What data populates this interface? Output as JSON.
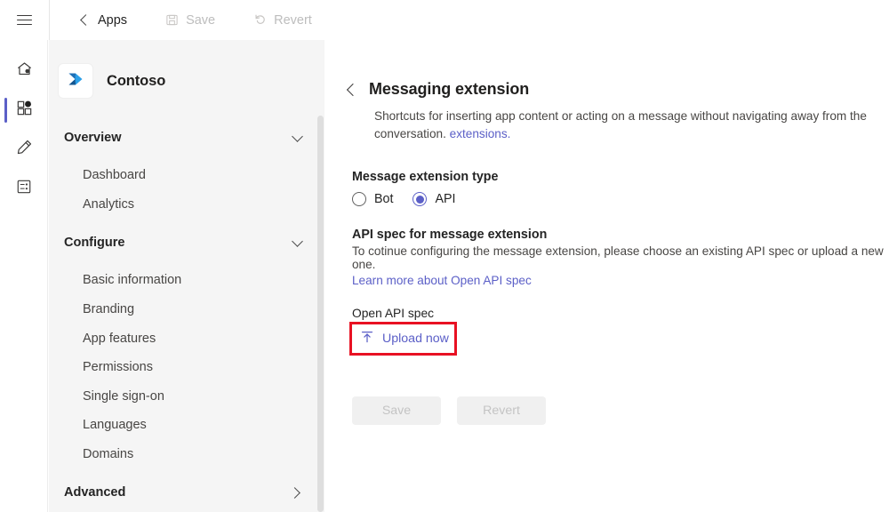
{
  "window": {
    "accent_purple": "#5b5fc7",
    "annotation_color": "#e81123"
  },
  "topbar": {
    "menu_icon": "hamburger-menu-icon",
    "back_label": "Apps",
    "save_label": "Save",
    "save_icon": "save-floppy-icon",
    "revert_label": "Revert",
    "revert_icon": "undo-arrow-icon"
  },
  "rail": {
    "items": [
      {
        "icon": "home-icon",
        "selected": false
      },
      {
        "icon": "apps-grid-icon",
        "selected": true
      },
      {
        "icon": "pencil-edit-icon",
        "selected": false
      },
      {
        "icon": "form-list-icon",
        "selected": false
      }
    ]
  },
  "sidebar": {
    "brand_name": "Contoso",
    "brand_logo_icon": "contoso-chevron-logo",
    "groups": [
      {
        "label": "Overview",
        "expanded": true,
        "chevron": "chevron-down-icon",
        "children": [
          "Dashboard",
          "Analytics"
        ]
      },
      {
        "label": "Configure",
        "expanded": true,
        "chevron": "chevron-down-icon",
        "children": [
          "Basic information",
          "Branding",
          "App features",
          "Permissions",
          "Single sign-on",
          "Languages",
          "Domains"
        ]
      },
      {
        "label": "Advanced",
        "expanded": false,
        "chevron": "chevron-right-icon",
        "children": []
      }
    ]
  },
  "main": {
    "back_icon": "chevron-left-icon",
    "title": "Messaging extension",
    "description_text": "Shortcuts for inserting app content or acting on a message without navigating away from the conversation.",
    "description_link": "extensions.",
    "type_section": {
      "label": "Message extension type",
      "options": [
        {
          "label": "Bot",
          "checked": false
        },
        {
          "label": "API",
          "checked": true
        }
      ]
    },
    "spec_section": {
      "heading": "API spec for message extension",
      "note": "To cotinue configuring the message extension, please choose an existing API spec or upload a new one.",
      "learn_more": "Learn more about Open API spec"
    },
    "upload_section": {
      "field_label": "Open API spec",
      "button_label": "Upload now",
      "button_icon": "upload-arrow-icon",
      "annotated": true
    },
    "footer": {
      "save_label": "Save",
      "save_disabled": true,
      "revert_label": "Revert",
      "revert_disabled": true
    }
  }
}
